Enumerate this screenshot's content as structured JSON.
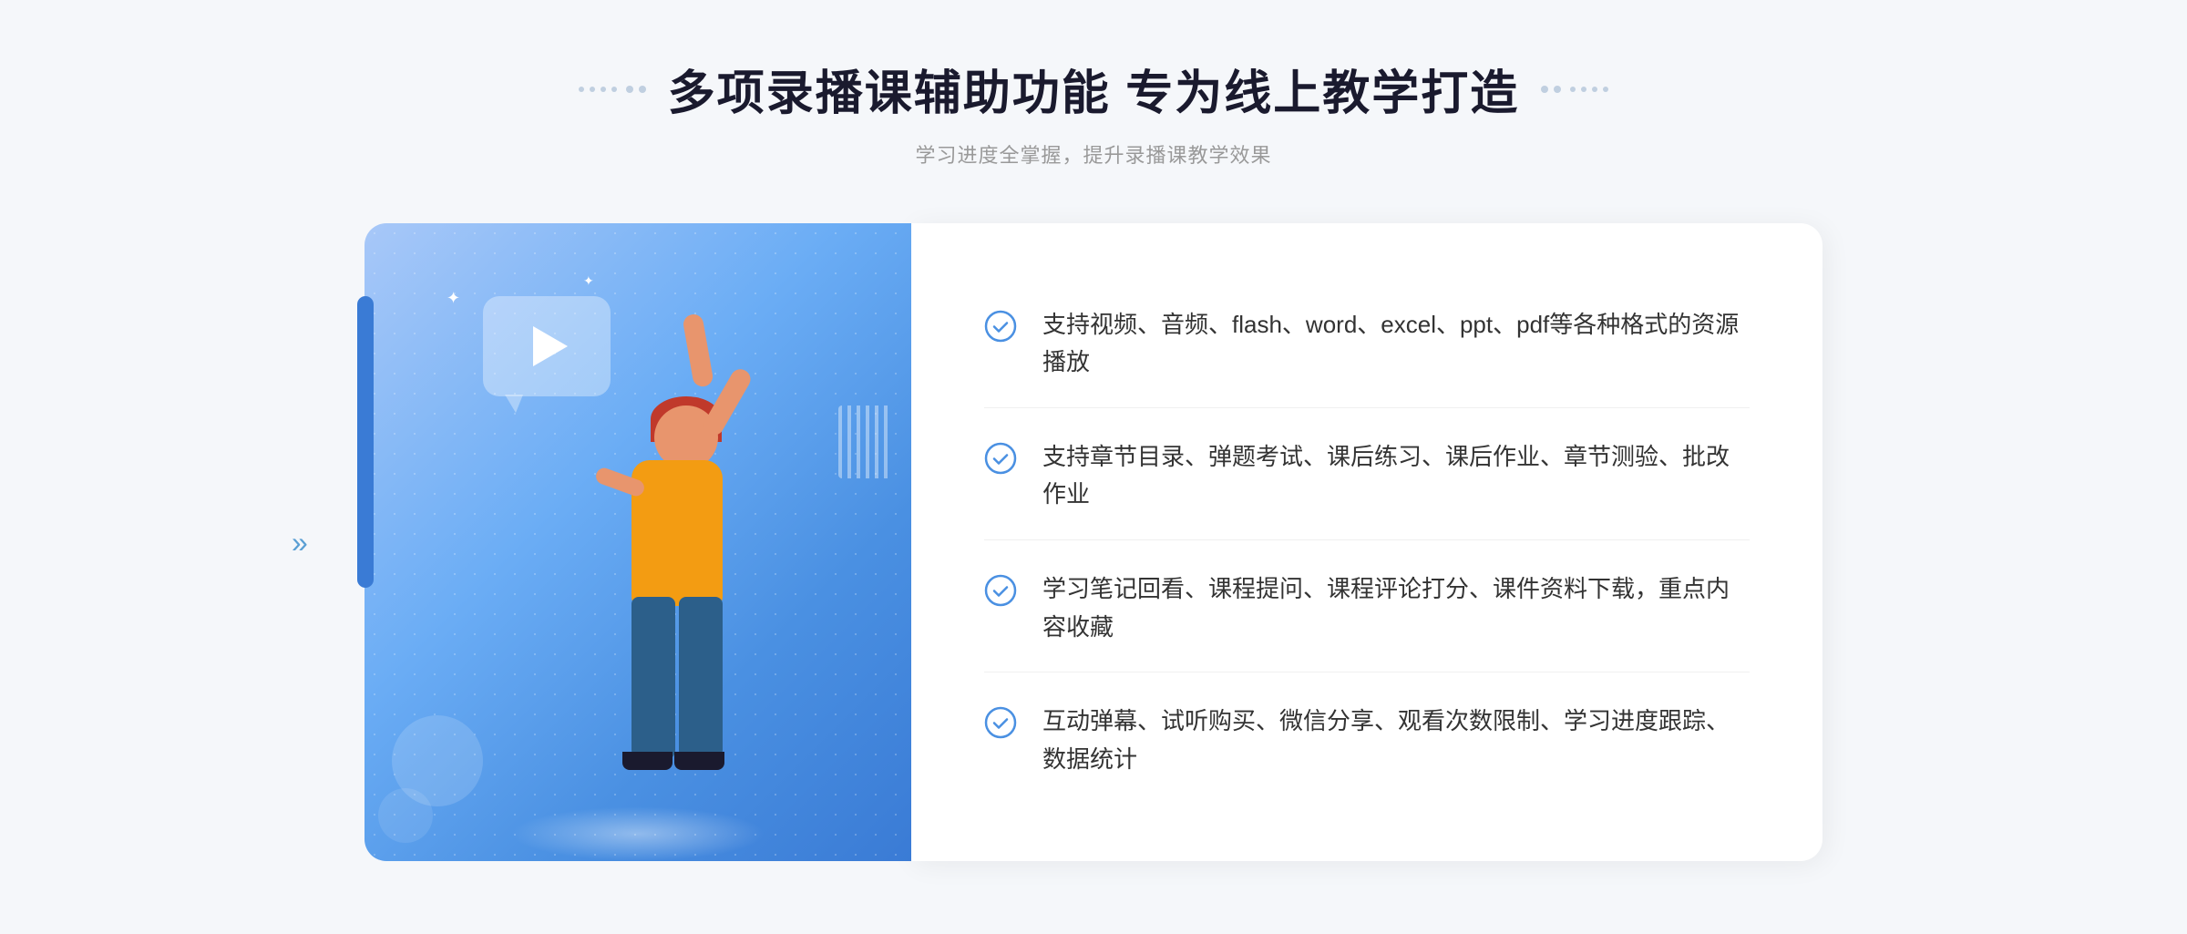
{
  "header": {
    "title": "多项录播课辅助功能 专为线上教学打造",
    "subtitle": "学习进度全掌握，提升录播课教学效果",
    "title_dots_left": "decorative dots left",
    "title_dots_right": "decorative dots right"
  },
  "features": [
    {
      "id": 1,
      "text": "支持视频、音频、flash、word、excel、ppt、pdf等各种格式的资源播放"
    },
    {
      "id": 2,
      "text": "支持章节目录、弹题考试、课后练习、课后作业、章节测验、批改作业"
    },
    {
      "id": 3,
      "text": "学习笔记回看、课程提问、课程评论打分、课件资料下载，重点内容收藏"
    },
    {
      "id": 4,
      "text": "互动弹幕、试听购买、微信分享、观看次数限制、学习进度跟踪、数据统计"
    }
  ],
  "icons": {
    "check": "check-circle",
    "play": "play-triangle",
    "chevron": "«"
  },
  "colors": {
    "primary_blue": "#4a90e2",
    "dark_blue": "#1a1a2e",
    "text_main": "#333333",
    "text_sub": "#999999",
    "check_color": "#4a90e2"
  }
}
